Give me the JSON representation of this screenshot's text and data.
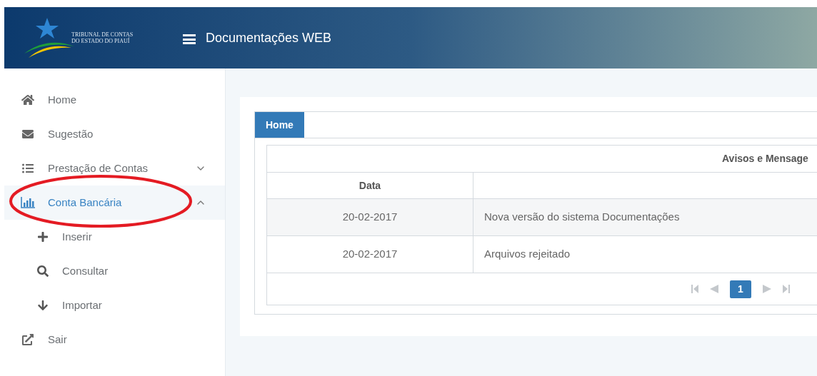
{
  "header": {
    "logo_lines": [
      "TRIBUNAL DE CONTAS",
      "DO ESTADO DO PIAUÍ"
    ],
    "title": "Documentações WEB"
  },
  "sidebar": {
    "items": [
      {
        "label": "Home",
        "selected": false
      },
      {
        "label": "Sugestão",
        "selected": false
      },
      {
        "label": "Prestação de Contas",
        "selected": false,
        "expanded": false
      },
      {
        "label": "Conta Bancária",
        "selected": true,
        "expanded": true,
        "children": [
          {
            "label": "Inserir"
          },
          {
            "label": "Consultar"
          },
          {
            "label": "Importar"
          }
        ]
      },
      {
        "label": "Sair",
        "selected": false
      }
    ]
  },
  "tabs": [
    {
      "label": "Home",
      "selected": true
    }
  ],
  "table": {
    "title": "Avisos e Mensage",
    "columns": [
      "Data"
    ],
    "rows": [
      {
        "date": "20-02-2017",
        "message": "Nova versão do sistema Documentações"
      },
      {
        "date": "20-02-2017",
        "message": "Arquivos rejeitado"
      }
    ],
    "pagination": [
      {
        "label": "1",
        "selected": true
      }
    ]
  }
}
